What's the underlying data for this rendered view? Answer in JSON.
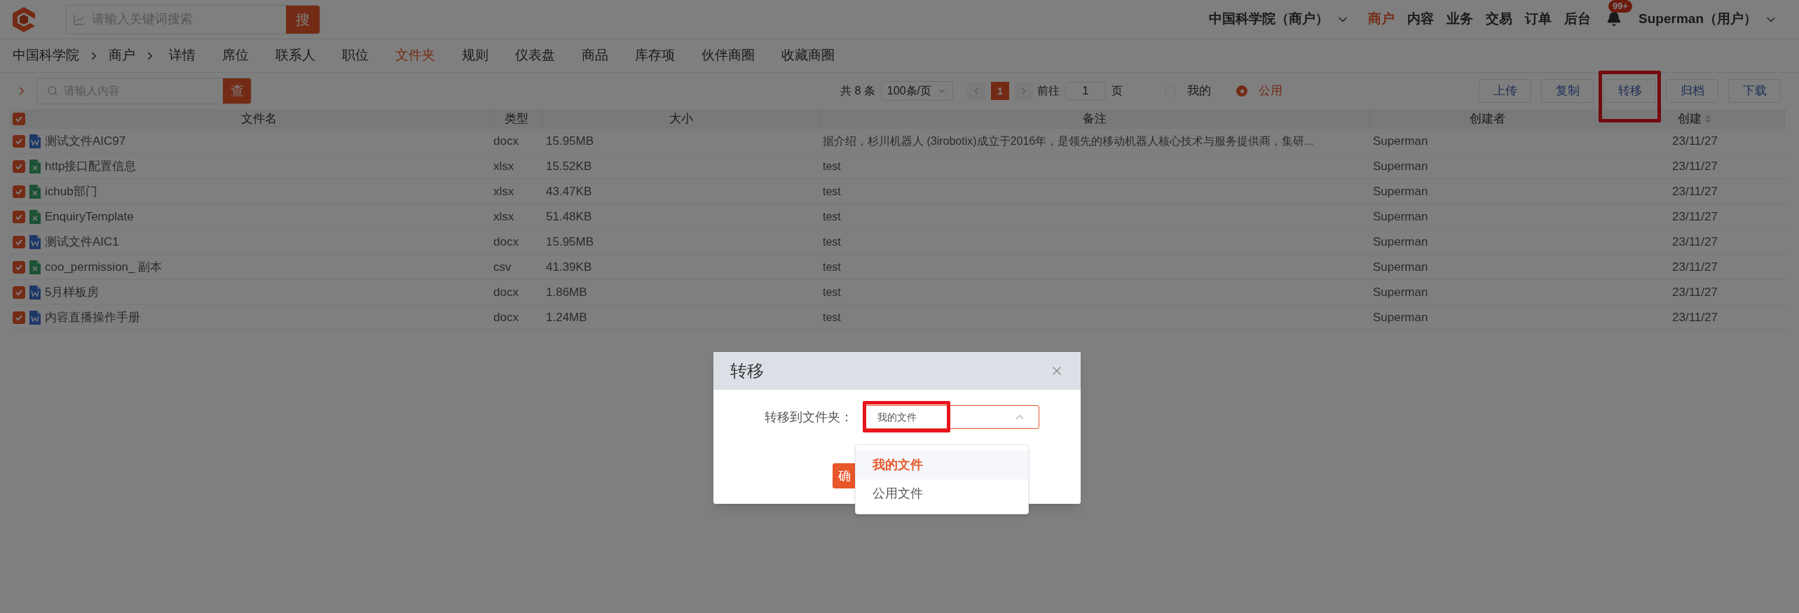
{
  "header": {
    "search": {
      "placeholder": "请输入关键词搜索",
      "button": "搜"
    },
    "org_switch": "中国科学院（商户）",
    "org_switch_expanded": false,
    "nav": [
      {
        "label": "商户",
        "selected": true
      },
      {
        "label": "内容",
        "selected": false
      },
      {
        "label": "业务",
        "selected": false
      },
      {
        "label": "交易",
        "selected": false
      },
      {
        "label": "订单",
        "selected": false
      },
      {
        "label": "后台",
        "selected": false
      }
    ],
    "notification_badge": "99+",
    "user": "Superman（用户）"
  },
  "breadcrumb": [
    "中国科学院",
    "商户"
  ],
  "tabs": [
    {
      "label": "详情",
      "selected": false
    },
    {
      "label": "席位",
      "selected": false
    },
    {
      "label": "联系人",
      "selected": false
    },
    {
      "label": "职位",
      "selected": false
    },
    {
      "label": "文件夹",
      "selected": true
    },
    {
      "label": "规则",
      "selected": false
    },
    {
      "label": "仪表盘",
      "selected": false
    },
    {
      "label": "商品",
      "selected": false
    },
    {
      "label": "库存项",
      "selected": false
    },
    {
      "label": "伙伴商圈",
      "selected": false
    },
    {
      "label": "收藏商圈",
      "selected": false
    }
  ],
  "toolbar": {
    "search": {
      "placeholder": "请输入内容",
      "button": "查"
    },
    "pagination": {
      "total": "共 8 条",
      "page_size": "100条/页",
      "current_page": "1",
      "goto_label": "前往",
      "goto_value": "1",
      "page_unit": "页"
    },
    "scope": [
      {
        "label": "我的",
        "selected": false
      },
      {
        "label": "公用",
        "selected": true
      }
    ],
    "actions": [
      {
        "label": "上传",
        "highlighted": false
      },
      {
        "label": "复制",
        "highlighted": false
      },
      {
        "label": "转移",
        "highlighted": true
      },
      {
        "label": "归档",
        "highlighted": false
      },
      {
        "label": "下载",
        "highlighted": false
      }
    ]
  },
  "table": {
    "all_checked": true,
    "columns": [
      {
        "label": "文件名"
      },
      {
        "label": "类型"
      },
      {
        "label": "大小"
      },
      {
        "label": "备注"
      },
      {
        "label": "创建者"
      },
      {
        "label": "创建",
        "sortable": true
      }
    ],
    "rows": [
      {
        "checked": true,
        "kind": "word",
        "name": "测试文件AIC97",
        "type": "docx",
        "size": "15.95MB",
        "note": "据介绍，杉川机器人 (3irobotix)成立于2016年，是领先的移动机器人核心技术与服务提供商，集研...",
        "creator": "Superman",
        "created": "23/11/27"
      },
      {
        "checked": true,
        "kind": "sheet",
        "name": "http接口配置信息",
        "type": "xlsx",
        "size": "15.52KB",
        "note": "test",
        "creator": "Superman",
        "created": "23/11/27"
      },
      {
        "checked": true,
        "kind": "sheet",
        "name": "ichub部门",
        "type": "xlsx",
        "size": "43.47KB",
        "note": "test",
        "creator": "Superman",
        "created": "23/11/27"
      },
      {
        "checked": true,
        "kind": "sheet",
        "name": "EnquiryTemplate",
        "type": "xlsx",
        "size": "51.48KB",
        "note": "test",
        "creator": "Superman",
        "created": "23/11/27"
      },
      {
        "checked": true,
        "kind": "word",
        "name": "测试文件AIC1",
        "type": "docx",
        "size": "15.95MB",
        "note": "test",
        "creator": "Superman",
        "created": "23/11/27"
      },
      {
        "checked": true,
        "kind": "sheet",
        "name": "coo_permission_ 副本",
        "type": "csv",
        "size": "41.39KB",
        "note": "test",
        "creator": "Superman",
        "created": "23/11/27"
      },
      {
        "checked": true,
        "kind": "word",
        "name": "5月样板房",
        "type": "docx",
        "size": "1.86MB",
        "note": "test",
        "creator": "Superman",
        "created": "23/11/27"
      },
      {
        "checked": true,
        "kind": "word",
        "name": "内容直播操作手册",
        "type": "docx",
        "size": "1.24MB",
        "note": "test",
        "creator": "Superman",
        "created": "23/11/27"
      }
    ]
  },
  "dialog": {
    "title": "转移",
    "field_label": "转移到文件夹：",
    "value": "我的文件",
    "value_highlighted": true,
    "open": true,
    "options": [
      {
        "label": "我的文件",
        "selected": true
      },
      {
        "label": "公用文件",
        "selected": false
      }
    ],
    "confirm": "确"
  }
}
